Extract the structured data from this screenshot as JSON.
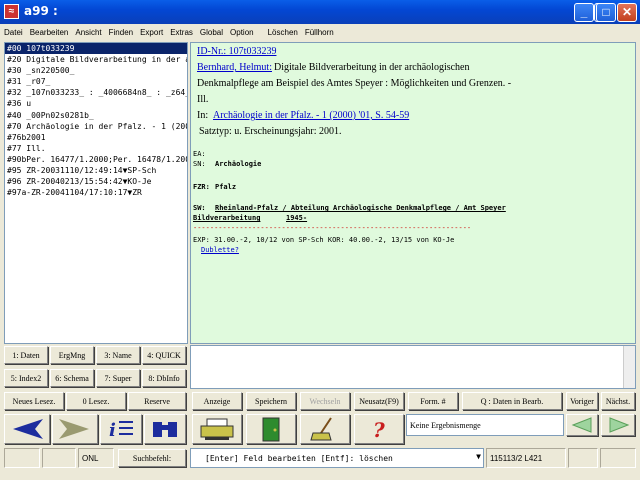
{
  "window": {
    "title": "a99 :"
  },
  "menu": [
    "Datei",
    "Bearbeiten",
    "Ansicht",
    "Finden",
    "Export",
    "Extras",
    "Global",
    "Option",
    "Löschen",
    "Füllhorn"
  ],
  "left_lines": [
    "#00 107t033239",
    "#20 Digitale Bildverarbeitung in der ar",
    "#30 _sn220500_",
    "#31 _r07_",
    "#32 _107n033233_ : _4006684n8_ : _z64_",
    "#36 u",
    "#40 _00Pn02s0281b_",
    "#70 Archäologie in der Pfalz. - 1 (2000",
    "#76b2001",
    "#77 Ill.",
    "#90bPer. 16477/1.2000;Per. 16478/1.200",
    "#95 ZR-20031110/12:49:14▼SP-Sch",
    "#96 ZR-20040213/15:54:42▼KO-Je",
    "#97a-ZR-20041104/17:10:17▼ZR"
  ],
  "record": {
    "id_link": "ID-Nr.: 107t033239",
    "author_link": "Bernhard, Helmut:",
    "title_line1": "Digitale Bildverarbeitung in der archäologischen",
    "title_line2": "Denkmalpflege am Beispiel des Amtes Speyer : Möglichkeiten und Grenzen. -",
    "ill": "Ill.",
    "in_label": "In:",
    "in_link": "Archäologie in der Pfalz. - 1 (2000) '01, S. 54-59",
    "satztyp": "Satztyp: u. Erscheinungsjahr: 2001.",
    "ea": "EA:",
    "sn_label": "SN:",
    "sn_value": "Archäologie",
    "fzr_label": "FZR:",
    "fzr_value": "Pfalz",
    "sw_label": "SW:",
    "sw_value1": "Rheinland-Pfalz / Abteilung Archäologische Denkmalpflege / Amt Speyer",
    "sw_value2": "Bildverarbeitung",
    "sw_year": "1945-",
    "dashes": "------------------------------------------------------------------",
    "exp": "EXP: 31.00.-2, 10/12 von SP-Sch  KOR: 40.00.-2, 13/15 von KO-Je",
    "dublette": "Dublette?"
  },
  "left_buttons": [
    [
      "1: Daten",
      "ErgMng",
      "3: Name",
      "4: QUICK"
    ],
    [
      "5: Index2",
      "6: Schema",
      "7: Super",
      "8: DbInfo"
    ]
  ],
  "row1_buttons": {
    "neues_lesez": "Neues Lesez.",
    "lesez0": "0 Lesez.",
    "reserve": "Reserve",
    "anzeige": "Anzeige",
    "speichern": "Speichern",
    "wechseln": "Wechseln",
    "neusatz": "Neusatz(F9)",
    "form": "Form. #",
    "q_daten": "Q : Daten in Bearb.",
    "voriger": "Voriger",
    "naechst": "Nächst."
  },
  "ergebnis": "Keine Ergebnismenge",
  "icons": {
    "back": "arrow-left-icon",
    "forward": "arrow-right-icon",
    "info": "info-icon",
    "binoculars": "binoculars-icon",
    "printer": "printer-icon",
    "door": "door-icon",
    "broom": "broom-icon",
    "help": "help-icon"
  },
  "status": {
    "onl": "ONL",
    "suchbefehl": "Suchbefehl:",
    "command": "[Enter] Feld bearbeiten   [Entf]: löschen",
    "code": "115113/2 L421"
  }
}
